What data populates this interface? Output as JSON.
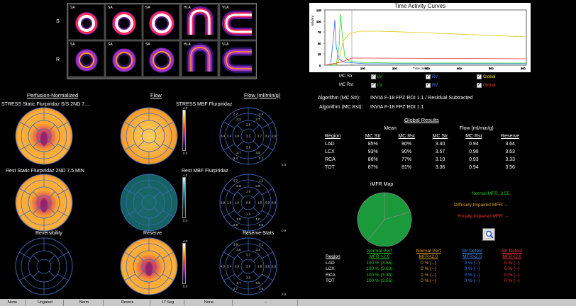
{
  "strip": {
    "row_labels": [
      "S",
      "R"
    ],
    "top": [
      "SA",
      "SA",
      "SA",
      "HLA",
      "VLA"
    ],
    "bottom": [
      "SA",
      "SA",
      "SA",
      "HLA",
      "VLA"
    ]
  },
  "panels": {
    "perfusion_header": "Perfusion-Normalized",
    "flow_header": "Flow",
    "flow_units_header": "Flow (ml/min/g)",
    "stress_caption": "STRESS Static Flurpiridaz S/S 2ND 7....",
    "stress_mbf_caption": "STRESS MBF Flurpiridaz",
    "rest_caption": "Rest Static Flurpiridaz 2ND 7.5 MIN",
    "rest_mbf_caption": "Rest MBF Flurpiridaz",
    "reversibility": "Reversibility",
    "reserve": "Reserve",
    "reserve_stats": "Reserve-Stats",
    "scale_max": "4.0",
    "scale_min": "0.0",
    "corner_values": [
      "3.4",
      "0.9",
      "3.6"
    ]
  },
  "tac": {
    "title": "Time Activity Curves",
    "ylabel": "kBq/ml",
    "xlabel": "Time (sec)"
  },
  "legend": {
    "mc_str": "MC Str",
    "mc_rst": "MC Rst",
    "lv": "LV",
    "rv": "RV",
    "global": "Global",
    "colors": {
      "lv": "#22dd22",
      "rv": "#3a7aff",
      "global_str": "#e8e020",
      "global_rst": "#ff3030"
    }
  },
  "algorithms": {
    "str_label": "Algorithm (MC Str):",
    "str_value": "INVIA F-18 FPZ ROI 1.1 / Residual Subtracted",
    "rst_label": "Algorithm (MC Rst):",
    "rst_value": "INVIA F-18 FPZ ROI 1.1"
  },
  "results": {
    "title": "Global Results",
    "group_mean": "Mean",
    "group_flow": "Flow (ml/min/g)",
    "columns": [
      "Region",
      "MC Str",
      "MC Rst",
      "MC Str",
      "MC Rst",
      "Reserve"
    ],
    "rows": [
      [
        "LAD",
        "85%",
        "80%",
        "3.40",
        "0.94",
        "3.64"
      ],
      [
        "LCX",
        "93%",
        "90%",
        "3.57",
        "0.98",
        "3.63"
      ],
      [
        "RCA",
        "86%",
        "77%",
        "3.10",
        "0.93",
        "3.33"
      ],
      [
        "TOT",
        "87%",
        "81%",
        "3.36",
        "0.94",
        "3.56"
      ]
    ]
  },
  "imfr": {
    "title": "iMFR Map",
    "normal": "Normal MFR: 3.55",
    "diffuse": "Diffusely Impaired MFR: --",
    "focal": "Focally Impaired MFR: --",
    "head1": [
      "",
      "Normal Perf",
      "Normal Perf",
      "Str Defect",
      "Str Defect"
    ],
    "head2": [
      "Region",
      "MFR >2.0",
      "MFR<2.0",
      "MFR>2.0",
      "MFR<2.0"
    ],
    "rows": [
      [
        "LAD",
        "100 %  (3.65)",
        "0 %  (--)",
        "0 %  (--)",
        "0 %  (--)"
      ],
      [
        "LCX",
        "100 %  (3.63)",
        "0 %  (--)",
        "0 %  (--)",
        "0 %  (--)"
      ],
      [
        "RCA",
        "100 %  (3.33)",
        "0 %  (--)",
        "0 %  (--)",
        "0 %  (--)"
      ],
      [
        "TOT",
        "100 %  (3.55)",
        "0 %  (--)",
        "0 %  (--)",
        "0 %  (--)"
      ]
    ],
    "colors": [
      "#ffffff",
      "#22cc22",
      "#e8a020",
      "#3a8aff",
      "#ff3030"
    ]
  },
  "statusbar": [
    "None",
    "Ungated",
    "Norm",
    "Revers",
    "17 Seg",
    "None",
    "--"
  ]
}
